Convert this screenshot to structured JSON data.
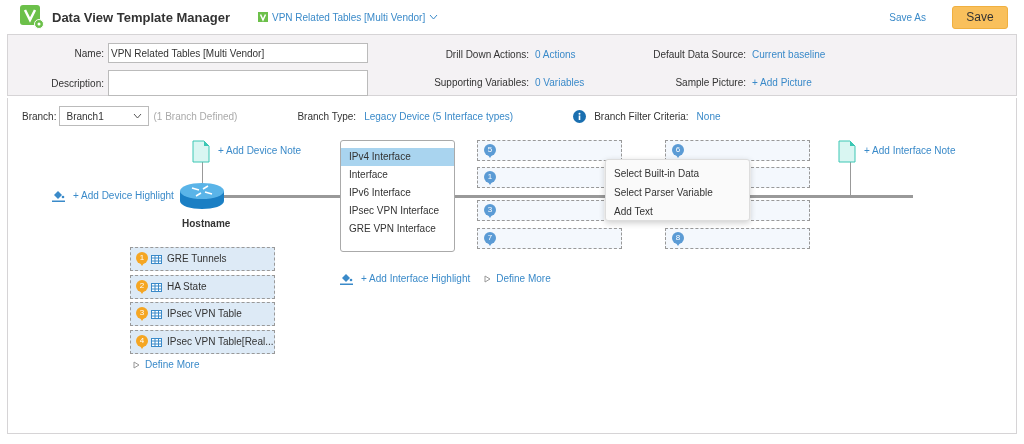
{
  "header": {
    "app_title": "Data View Template Manager",
    "template": "VPN Related Tables [Multi Vendor]",
    "save_as": "Save As",
    "save": "Save"
  },
  "form": {
    "fields": [
      {
        "label": "Name:",
        "value": "VPN Related Tables [Multi Vendor]"
      },
      {
        "label": "Description:"
      }
    ],
    "middle": [
      {
        "label": "Drill Down Actions:",
        "value": "0 Actions"
      },
      {
        "label": "Supporting Variables:",
        "value": "0 Variables"
      }
    ],
    "right": [
      {
        "label": "Default Data Source:",
        "value": "Current baseline"
      },
      {
        "label": "Sample Picture:",
        "value": "+ Add Picture"
      }
    ]
  },
  "branch_bar": {
    "label": "Branch:",
    "value": "Branch1",
    "hint": "(1 Branch Defined)",
    "type_label": "Branch Type:",
    "type_value": "Legacy Device (5 Interface types)",
    "filter_label": "Branch Filter Criteria:",
    "filter_value": "None"
  },
  "diagram": {
    "device_note": "+ Add Device Note",
    "device_highlight": "+ Add Device Highlight",
    "hostname": "Hostname",
    "device_tables": [
      {
        "number": "1",
        "label": "GRE Tunnels"
      },
      {
        "number": "2",
        "label": "HA State"
      },
      {
        "number": "3",
        "label": "IPsec VPN Table"
      },
      {
        "number": "4",
        "label": "IPsec VPN Table[Real..."
      }
    ],
    "device_define_more": "Define More",
    "interface_types": [
      {
        "label": "IPv4 Interface",
        "selected": true
      },
      {
        "label": "Interface",
        "selected": false
      },
      {
        "label": "IPv6 Interface",
        "selected": false
      },
      {
        "label": "IPsec VPN Interface",
        "selected": false
      },
      {
        "label": "GRE VPN Interface",
        "selected": false
      }
    ],
    "slot_columns": [
      [
        {
          "number": "5",
          "kind": "full"
        },
        {
          "number": "1",
          "kind": "covered"
        },
        {
          "number": "3",
          "kind": "covered"
        },
        {
          "number": "7",
          "kind": "full"
        }
      ],
      [
        {
          "number": "6",
          "kind": "full"
        },
        {
          "kind": "covered"
        },
        {
          "kind": "covered"
        },
        {
          "number": "8",
          "kind": "full"
        }
      ]
    ],
    "interface_highlight": "+ Add Interface Highlight",
    "interface_define_more": "Define More",
    "interface_note": "+ Add Interface Note",
    "context_menu": [
      "Select Built-in Data",
      "Select Parser Variable",
      "Add Text"
    ]
  }
}
